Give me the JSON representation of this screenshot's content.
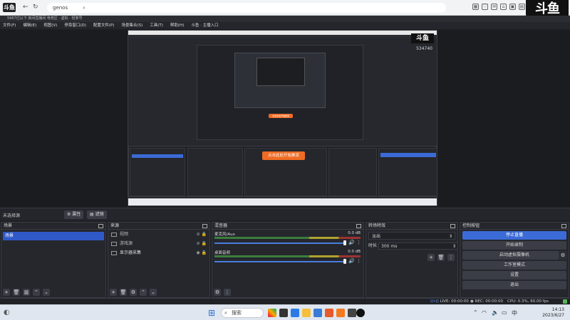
{
  "browser": {
    "logo": "斗鱼",
    "tab_text": "genos",
    "url_text": "",
    "right_icons": [
      "qr-icon",
      "heart-icon",
      "mail-icon",
      "shirt-icon",
      "bag-icon",
      "ticket-icon",
      "bell-icon"
    ],
    "brand_big": "斗鱼"
  },
  "infobar": {
    "text": "5967亿以下  房间直播间  电竞区 · 虚拟 · 轻率号"
  },
  "menubar": {
    "items": [
      "文件(F)",
      "编辑(E)",
      "视图(V)",
      "停靠窗口(D)",
      "配置文件(P)",
      "场景集合(S)",
      "工具(T)",
      "帮助(H)",
      "斗鱼 · 主播入口"
    ]
  },
  "room_counter": "534740",
  "nested": {
    "brand": "斗鱼",
    "counter": "534740",
    "orange_btn": "点击此处开始推流",
    "orange_btn_small": "点击此处开始推流"
  },
  "sources_bar": {
    "no_source": "未选择源",
    "properties_label": "属性",
    "filters_label": "滤镜"
  },
  "scenes": {
    "title": "场景",
    "items": [
      "场景"
    ]
  },
  "sources": {
    "title": "来源",
    "items": [
      {
        "name": "视频",
        "icon": "monitor-icon",
        "visible": false
      },
      {
        "name": "游戏源",
        "icon": "gamepad-icon",
        "visible": false
      },
      {
        "name": "显示器采集",
        "icon": "monitor-icon",
        "visible": true
      }
    ]
  },
  "mixer": {
    "title": "混音器",
    "channels": [
      {
        "name": "麦克风/Aux",
        "db": "0.0 dB"
      },
      {
        "name": "桌面音频",
        "db": "0.0 dB"
      }
    ]
  },
  "transitions": {
    "title": "转场特效",
    "selected": "淡出",
    "duration_label": "时长",
    "duration_value": "300 ms"
  },
  "controls": {
    "title": "控制按钮",
    "buttons": [
      "停止直播",
      "开始录制",
      "启动虚拟摄像机",
      "工作室模式",
      "设置",
      "退出"
    ]
  },
  "status": {
    "live": "LIVE: 00:00:00",
    "rec": "REC: 00:00:00",
    "cpu": "CPU: 0.3%, 60.00 fps"
  },
  "taskbar": {
    "search_placeholder": "搜索",
    "time": "14:13",
    "date": "2023/6/27"
  }
}
